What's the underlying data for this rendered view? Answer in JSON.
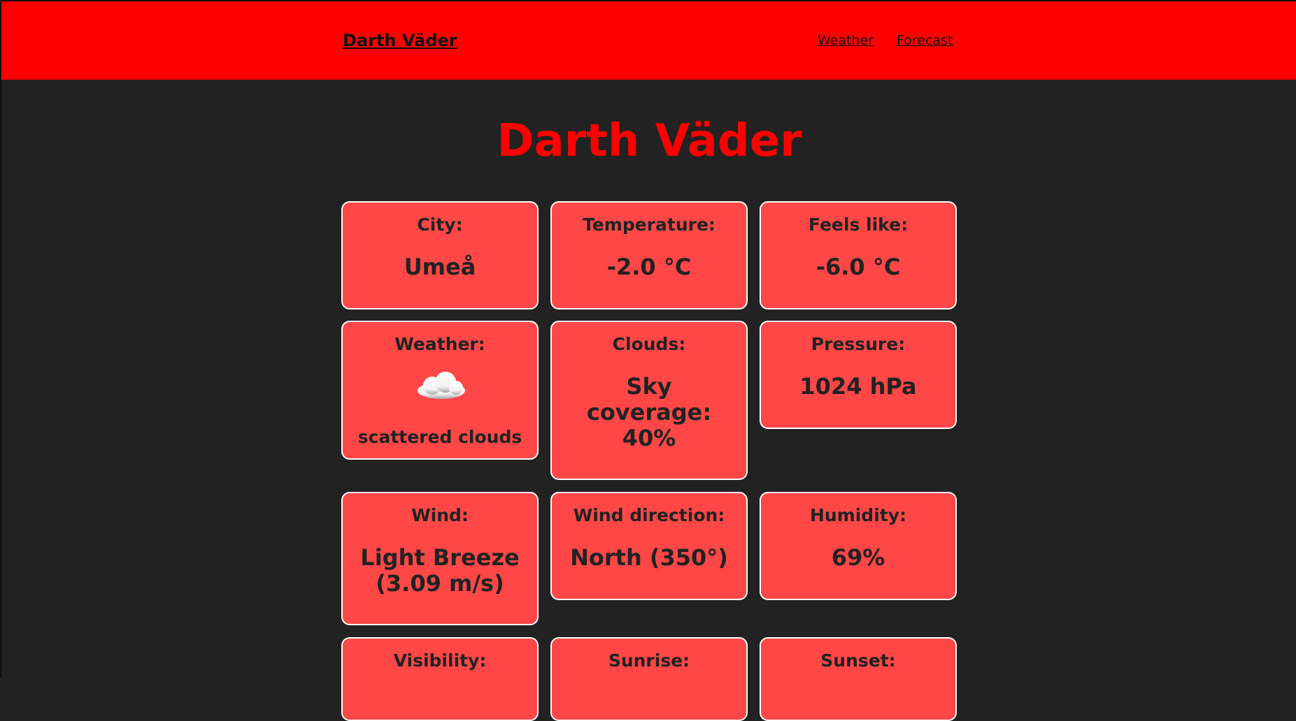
{
  "nav": {
    "brand": "Darth Väder",
    "links": [
      "Weather",
      "Forecast"
    ]
  },
  "page": {
    "title": "Darth Väder"
  },
  "colors": {
    "navbar": "#ff0000",
    "background": "#222222",
    "card": "#ff4747",
    "title": "#ff0000"
  },
  "cards": {
    "city": {
      "label": "City:",
      "value": "Umeå"
    },
    "temperature": {
      "label": "Temperature:",
      "value": "-2.0 °C"
    },
    "feels_like": {
      "label": "Feels like:",
      "value": "-6.0 °C"
    },
    "weather": {
      "label": "Weather:",
      "icon": "cloud-icon",
      "value": "scattered clouds"
    },
    "clouds": {
      "label": "Clouds:",
      "value": "Sky coverage: 40%"
    },
    "pressure": {
      "label": "Pressure:",
      "value": "1024 hPa"
    },
    "wind": {
      "label": "Wind:",
      "value": "Light Breeze (3.09 m/s)"
    },
    "wind_direction": {
      "label": "Wind direction:",
      "value": "North (350°)"
    },
    "humidity": {
      "label": "Humidity:",
      "value": "69%"
    },
    "visibility": {
      "label": "Visibility:"
    },
    "sunrise": {
      "label": "Sunrise:"
    },
    "sunset": {
      "label": "Sunset:"
    }
  }
}
